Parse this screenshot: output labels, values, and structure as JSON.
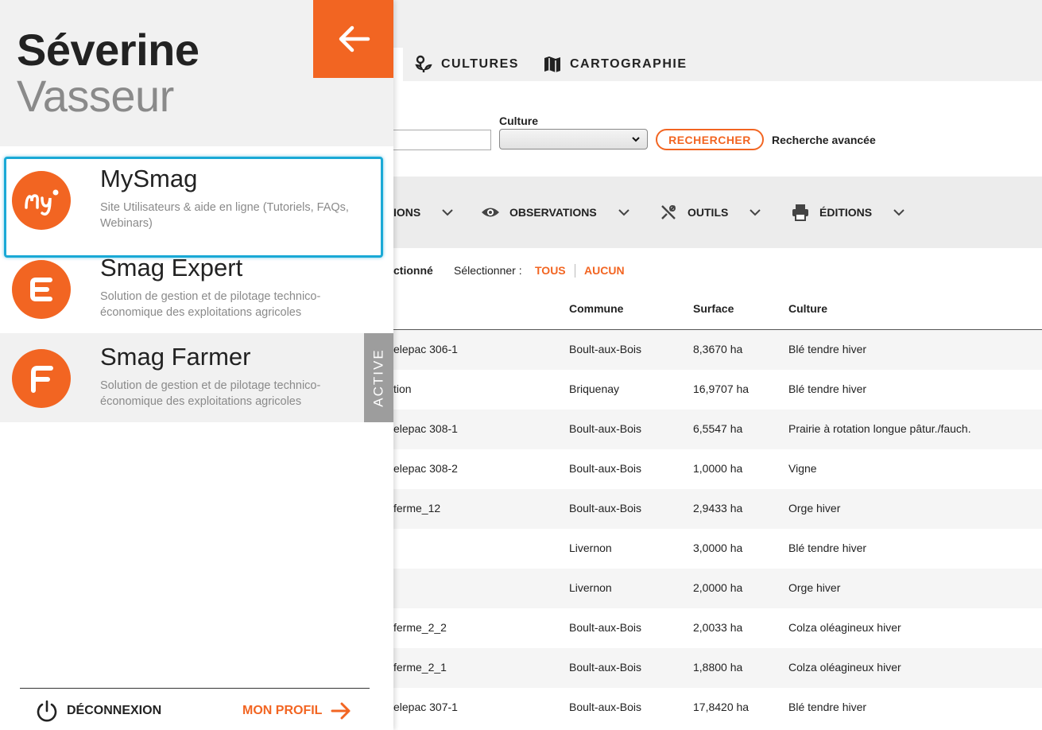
{
  "colors": {
    "accent": "#f26522",
    "focus": "#1aa9d6",
    "active_badge": "#9d9d9d"
  },
  "nav": {
    "tabs": [
      {
        "label": "CULTURES",
        "icon": "seedling-icon"
      },
      {
        "label": "CARTOGRAPHIE",
        "icon": "map-icon"
      }
    ]
  },
  "search": {
    "culture_label": "Culture",
    "culture_value": "",
    "search_button": "RECHERCHER",
    "advanced_link": "Recherche avancée"
  },
  "toolbar": {
    "items": [
      {
        "label": "IONS",
        "icon": ""
      },
      {
        "label": "OBSERVATIONS",
        "icon": "eye-icon"
      },
      {
        "label": "OUTILS",
        "icon": "tools-icon"
      },
      {
        "label": "ÉDITIONS",
        "icon": "printer-icon"
      }
    ]
  },
  "selection": {
    "partial_text": "ctionné",
    "label": "Sélectionner :",
    "all": "TOUS",
    "none": "AUCUN"
  },
  "table": {
    "headers": [
      "",
      "Commune",
      "Surface",
      "Culture"
    ],
    "rows": [
      [
        "elepac 306-1",
        "Boult-aux-Bois",
        "8,3670 ha",
        "Blé tendre hiver"
      ],
      [
        "tion",
        "Briquenay",
        "16,9707 ha",
        "Blé tendre hiver"
      ],
      [
        "elepac 308-1",
        "Boult-aux-Bois",
        "6,5547 ha",
        "Prairie à rotation longue pâtur./fauch."
      ],
      [
        "elepac 308-2",
        "Boult-aux-Bois",
        "1,0000 ha",
        "Vigne"
      ],
      [
        " ferme_12",
        "Boult-aux-Bois",
        "2,9433 ha",
        "Orge hiver"
      ],
      [
        "",
        "Livernon",
        "3,0000 ha",
        "Blé tendre hiver"
      ],
      [
        "",
        "Livernon",
        "2,0000 ha",
        "Orge hiver"
      ],
      [
        " ferme_2_2",
        "Boult-aux-Bois",
        "2,0033 ha",
        "Colza oléagineux hiver"
      ],
      [
        " ferme_2_1",
        "Boult-aux-Bois",
        "1,8800 ha",
        "Colza oléagineux hiver"
      ],
      [
        "elepac 307-1",
        "Boult-aux-Bois",
        "17,8420 ha",
        "Blé tendre hiver"
      ]
    ]
  },
  "drawer": {
    "first_name": "Séverine",
    "last_name": "Vasseur",
    "back_icon": "arrow-left-icon",
    "apps": [
      {
        "name": "MySmag",
        "description": "Site Utilisateurs & aide en ligne (Tutoriels, FAQs, Webinars)",
        "logo": "mysmag-logo"
      },
      {
        "name": "Smag Expert",
        "description": "Solution de gestion et de pilotage technico-économique des exploitations agricoles",
        "logo": "smag-expert-logo"
      },
      {
        "name": "Smag Farmer",
        "description": "Solution de gestion et de pilotage technico-économique des exploitations agricoles",
        "logo": "smag-farmer-logo",
        "badge": "ACTIVE"
      }
    ],
    "logout_label": "DÉCONNEXION",
    "profile_label": "MON PROFIL"
  }
}
